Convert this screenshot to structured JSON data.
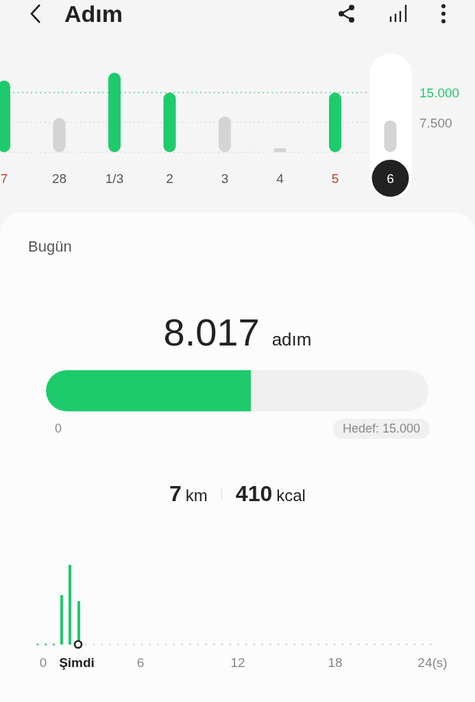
{
  "header": {
    "title": "Adım"
  },
  "daily_chart": {
    "chart_data": {
      "type": "bar",
      "categories": [
        "7",
        "28",
        "1/3",
        "2",
        "3",
        "4",
        "5",
        "6"
      ],
      "series": [
        {
          "color": "#1ecb6c",
          "values": [
            18000,
            null,
            20000,
            15000,
            null,
            null,
            15000,
            null
          ]
        },
        {
          "color": "#d4d4d4",
          "values": [
            null,
            8600,
            null,
            null,
            9000,
            1000,
            null,
            8000
          ]
        }
      ],
      "ylim": [
        0,
        20000
      ],
      "ref_lines": [
        {
          "axis": "y",
          "value": 7500,
          "color": "#cfcfcf"
        },
        {
          "axis": "y",
          "value": 15000,
          "color": "#1ecb6c"
        }
      ],
      "yticks": [
        {
          "value": 7500,
          "label": "7.500"
        },
        {
          "value": 15000,
          "label": "15.000"
        }
      ]
    },
    "days": [
      {
        "weekend": true,
        "selected": false
      },
      {
        "weekend": false,
        "selected": false
      },
      {
        "weekend": false,
        "selected": false
      },
      {
        "weekend": false,
        "selected": false
      },
      {
        "weekend": false,
        "selected": false
      },
      {
        "weekend": false,
        "selected": false
      },
      {
        "weekend": true,
        "selected": false
      },
      {
        "weekend": false,
        "selected": true
      }
    ]
  },
  "today": {
    "title": "Bugün",
    "steps": "8.017",
    "steps_unit": "adım",
    "progress": {
      "level": 0.535,
      "start_label": "0",
      "goal_label": "Hedef: 15.000"
    },
    "stats": [
      {
        "value": "7",
        "unit": "km"
      },
      {
        "value": "410",
        "unit": "kcal"
      }
    ],
    "hourly_chart": {
      "kind": "picture",
      "axis_labels": [
        {
          "label": "0",
          "current": false
        },
        {
          "label": "Şimdi",
          "current": true
        },
        {
          "label": "6",
          "current": false
        },
        {
          "label": "12",
          "current": false
        },
        {
          "label": "18",
          "current": false
        },
        {
          "label": "24(s)",
          "current": false
        }
      ]
    }
  }
}
